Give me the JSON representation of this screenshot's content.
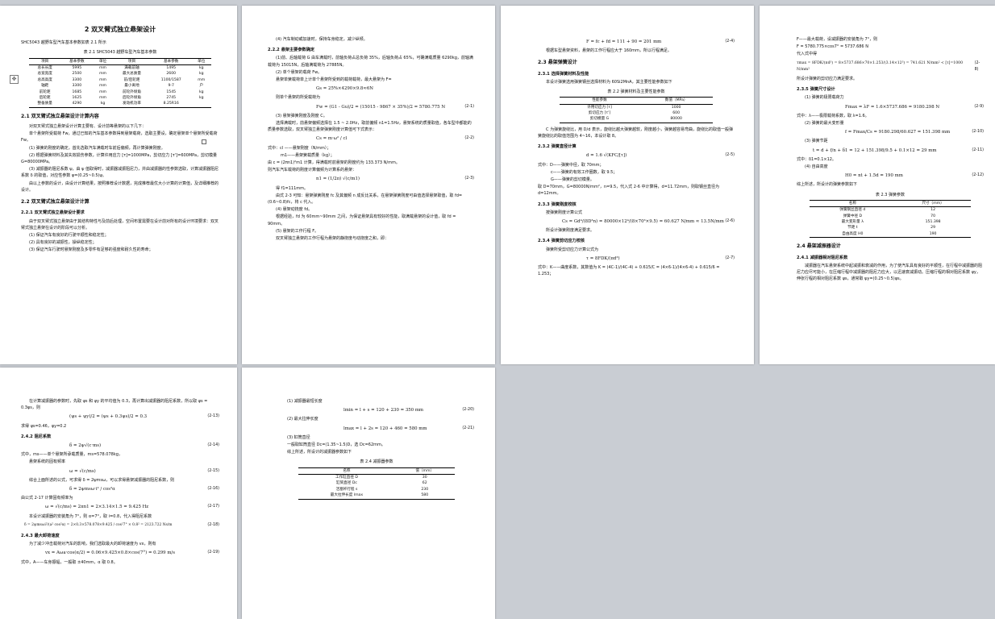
{
  "page1": {
    "chapter_title": "2 双叉臂式独立悬架设计",
    "intro_line": "SHC5043 越野车型汽车基本参数如表 2.1 所示",
    "table_caption": "表 2.1 SHC5043 越野车型汽车基本参数",
    "table_headers": [
      "项目",
      "基本参数",
      "单位",
      "项目",
      "基本参数",
      "单位"
    ],
    "table_rows": [
      [
        "总长长度",
        "5995",
        "mm",
        "满载前轴",
        "1495",
        "kg"
      ],
      [
        "总宽宽度",
        "2500",
        "mm",
        "最大总质量",
        "2600",
        "kg"
      ],
      [
        "总高高度",
        "3300",
        "mm",
        "前/后轮距",
        "1100/1587",
        "mm"
      ],
      [
        "轴距",
        "3300",
        "mm",
        "最小离地",
        "9-7",
        "户"
      ],
      [
        "前轮距",
        "1685",
        "mm",
        "前轮外倾角",
        "1545",
        "kg"
      ],
      [
        "后轮距",
        "1625",
        "mm",
        "后轮外倾角",
        "2745",
        "kg"
      ],
      [
        "整备质量",
        "4290",
        "kg",
        "发动机功率",
        "8.25R16",
        ""
      ]
    ],
    "s21_title": "2.1 双叉臂式独立悬架设计计算内容",
    "s21_paras": [
      "对双叉臂式独立悬架设计计算主要有、设计前等悬架的以下几下：",
      "单个悬架所受载荷 Fw，通过已知的汽车基本参数得到悬架载荷，选取主要设，确定悬架单个悬架所受载荷 Fw。",
      "(1) 弹簧的刚度的确定，首先选取汽车满载时车前后偏频，再计算弹簧刚度。",
      "(2) 根据弹簧材料及其失效损伤参数，计算许用应力 [τ]=1000MPa，剪切应力 [τ']=600MPa，剪切模量 G=80000MPa。",
      "(3) 减振器的阻尼系数 ψ，由 ψ 值取得时，减振器减振阻尼力，并由减振器的性参数选取，计算减振器阻尼系数 δ 的取值，对应性参数 ψ=(0.25~0.5)ψ。",
      "由以上参数的设计，由设计计算结果，按照推荐设计数据，完成推荐最优大小计算的计算值，及详细推荐的设计。"
    ],
    "s22_title": "2.2 双叉臂式独立悬架设计计算",
    "s221_title": "2.2.1 双叉臂式独立悬架设计要求",
    "s221_paras": [
      "由于双叉臂式独立悬架由于其结构特性与及前后处理，空间布置需要在设计前对所有的设计环境要求：双叉臂式独立悬架在设计的阶段可以分析。",
      "(1) 保证汽车有良好的行驶平顺性和稳定性；",
      "(2) 具有良好的减振性，操纵稳定性；",
      "(3) 保证汽车行驶时悬架刚度及多零件有足够的强度和耐久性的寿命；"
    ]
  },
  "page2": {
    "top_line": "(4) 汽车制动或加速时，保持车身稳定，减少纵倾。",
    "s222_title": "2.2.2 悬架主要参数确定",
    "paras_a": [
      "(1)前、后轴载荷 G 由车满载时，前轴负荷占总负荷 35%，后轴负荷占 65%，可确满载质量 6290kg，前轴满载荷为 15015N，后轴满载荷为 27885N。",
      "(2) 单个悬架的载荷 Fw。",
      "悬架单簧载荷单上计单个悬架所受到的载荷载荷，最大悬架为 F="
    ],
    "eq_gs": "Gs = 25%×4290×9.8≈6N",
    "para_b": "则单个悬架的所受载荷为",
    "eq_21": "Fw = (G1 - Gu)/2 = (15015 - 9867 × 35%)/2 = 5780.775 N",
    "eq_21_num": "(2-1)",
    "para_c": "(3) 悬架弹簧刚度及刚度 C。",
    "para_d": "选择满载时，前悬架偏频选择在 1.5 ~ 2.0Hz，取前偏频 n1=1.5Hz，悬架系统的质量取值，各车型中都能的质量参数选取，双叉臂独立悬架弹簧刚度计算值可下式表示：",
    "eq_22": "Cs = m·ω² / cl",
    "eq_22_num": "(2-2)",
    "defs": [
      "式中：cl ——悬架刚度（N/mm）；",
      "m1——悬架簧载质量（kg）；",
      "由 c = (2πn1)²m1 计算，得满载时前悬架的刚度约为 133.373 N/mm。",
      "则汽车汽车载荷的刚度计算偏频为计算系的悬架："
    ],
    "eq_23": "n1 = (1/2π) √(c/m1)",
    "eq_23_num": "(2-3)",
    "paras_e": [
      "得 f1=111mm。",
      "由式 2-3 可知：悬架弹簧刚度 fc 及其偏频 n 成反比关系，在悬架弹簧刚度可由值选择悬架取值，取 fd=(0.6~0.8)fc，将 c 代入。",
      "(4) 悬架动挠度 fd。",
      "根据经验，fd 为 60mm~90mm 之间，为保证悬架具有较好的性能，取满载悬架的设计值，取 fd = 90mm。",
      "(5) 悬架的工作行程 F。",
      "双叉臂独立悬架的工作行程为悬架的静挠度与动挠度之和，即："
    ]
  },
  "page3": {
    "eq_24": "F = fc + fd = 111 + 90 = 201 mm",
    "eq_24_num": "(2-4)",
    "line_a": "根据车型悬架资料，悬架的工作行程应大于 160mm，所以行程满足。",
    "s23_title": "2.3 悬架弹簧设计",
    "s231_title": "2.3.1 选择弹簧材料及性能",
    "line_b": "本设计弹簧选用弹簧钢丝选择材料为 60Si2MnA，其主要性能参数如下",
    "table_caption": "表 2.2 弹簧材料及主要性能参数",
    "table_headers": [
      "性能参数",
      "数值（MPa）"
    ],
    "table_rows": [
      [
        "许用切应力 [τ]",
        "1000"
      ],
      [
        "剪切应力 [τ']",
        "600"
      ],
      [
        "剪切模量 G",
        "80000"
      ]
    ],
    "line_c": "C 为弹簧旋绕比，用 D/d 表示，旋绕比越大弹簧越软，刚度越小，弹簧越容易弯曲，旋绕比的取值一般弹簧旋绕比的取值范围为 4~16，本设计取 8。",
    "s232_title": "2.3.2 弹簧直径计算",
    "eq_25": "d = 1.6 √(KFC/[τ])",
    "eq_25_num": "(2-5)",
    "defs": [
      "式中：D——弹簧中径，取 70mm；",
      "c——弹簧的有效工作圈数，取 9.5；",
      "G——弹簧的剪切模量。",
      "取 D=70mm，G=80000N/mm²，n=9.5，代入式 2-6 中计算得，d=11.72mm，则取钢丝直径为 d=12mm。"
    ],
    "s233_title": "2.3.3 弹簧刚度校核",
    "line_d": "按弹簧刚度计算公式",
    "eq_26": "Cs = Gd⁴/(8D³n) = 80000×12⁴/(8×70³×9.5) = 60.627 N/mm ≈ 13.5N/mm",
    "eq_26_num": "(2-6)",
    "line_e": "所设计弹簧刚度满足要求。",
    "s234_title": "2.3.4 弹簧剪切应力校核",
    "line_f": "弹簧所受剪切应力计算公式为",
    "eq_27": "τ = 8FDK/(πd³)",
    "eq_27_num": "(2-7)",
    "line_g": "式中：K——曲度系数，其数值为 K = (4C-1)/(4C-4) + 0.615/C = (4×6-1)/(4×6-4) + 0.615/6 = 1.253；"
  },
  "page4": {
    "line_a": "F——最大载荷，设减振器的安装角为 7°，则",
    "line_b": "F = 5780.775×cos7° = 5737.686 N",
    "line_c": "代入式中得",
    "eq_main": "τmax = 8FDK/(πd³) = 8×5737.686×70×1.253/(3.14×12³) = 741.621 N/mm² < [τ]=1000 N/mm²",
    "eq_main_num": "(2-8)",
    "line_d": "所设计弹簧的剪切应力满足要求。",
    "s235_title": "2.3.5 弹簧尺寸设计",
    "line_e": "(1) 弹簧的极限载荷力",
    "eq_29": "Fmax = λF = 1.6×5737.686 = 9180.298 N",
    "eq_29_num": "(2-9)",
    "line_f": "式中：λ——极限载荷系数，取 λ=1.6。",
    "line_g": "(2) 弹簧的最大变形量",
    "eq_210": "f = Fmax/Cs = 9180.298/60.627 = 151.398 mm",
    "eq_210_num": "(2-10)",
    "line_h": "(3) 弹簧节距",
    "eq_211": "t = d + f/n + δ1 = 12 + 151.398/9.5 + 0.1×12 = 29 mm",
    "eq_211_num": "(2-11)",
    "line_i": "式中：δ1=0.1×12。",
    "line_j": "(4) 自由高度",
    "eq_212": "H0 = nt + 1.5d = 190 mm",
    "eq_212_num": "(2-12)",
    "line_k": "综上所述，所设计的弹簧参数如下",
    "table_caption": "表 2.3 弹簧参数",
    "table_headers": [
      "名称",
      "尺寸（mm）"
    ],
    "table_rows": [
      [
        "弹簧钢丝直径 d",
        "12"
      ],
      [
        "弹簧中径 D",
        "70"
      ],
      [
        "最大变形量 λ",
        "151.398"
      ],
      [
        "节距 t",
        "29"
      ],
      [
        "自由高度 H0",
        "190"
      ]
    ],
    "s24_title": "2.4 悬架减振器设计",
    "s241_title": "2.4.1 减振器相对阻尼系数",
    "paras": [
      "减振器在汽车悬架系统中起减振和衰减的作用，为了使汽车具有良好的平顺性，在行程中减振器的阻尼力应尽可能小，在压缩行程中减振器的阻尼力应大，以迅速衰减振动。压缩行程的相对阻尼系数 ψy，伸张行程的相对阻尼系数 ψs，通常取 ψy=(0.25~0.5)ψs。"
    ]
  },
  "page5": {
    "paras_a": [
      "在计算减振器的参数时，先取 ψs 和 ψy 的平均值为 0.3，再计算出减振器的阻尼系数，所以取 ψs = 0.3ψs，则"
    ],
    "eq_213": "(ψs + ψy)/2 = (ψs + 0.3ψs)/2 = 0.3",
    "eq_213_num": "(2-13)",
    "line_a": "求得 ψs=0.46，ψy=0.2",
    "s242_title": "2.4.2 阻尼系数",
    "eq_214": "δ = 2ψ√(c·ms)",
    "eq_214_num": "(2-14)",
    "defs": [
      "式中，ms——单个悬架所承载质量，ms=578.078kg，",
      "悬架系统的固有频率"
    ],
    "eq_215": "ω = √(c/ms)",
    "eq_215_num": "(2-15)",
    "line_b": "综合上面所述的公式，可求得 δ = 2ψmsω，可以求得悬架减振器的阻尼系数，则",
    "eq_216": "δ = 2ψmsω·i² / cos²α",
    "eq_216_num": "(2-16)",
    "line_c": "由公式 2-17 计算固有频率为",
    "eq_217": "ω = √(c/ms) = 2πn1 = 2×3.14×1.5 = 9.425 Hz",
    "eq_217_num": "(2-17)",
    "line_d": "本设计减振器的安装角为 7°，则 α=7°，取 i=0.8，代入得阻尼系数",
    "eq_218": "δ = 2ψmsωi²/(a² cos²α) = 2×0.3×578.078×9.425 / cos²7° × 0.8² = 2123.722 Ns/m",
    "eq_218_num": "(2-18)",
    "s243_title": "2.4.3 最大卸荷速度",
    "line_e": "为了减少冲击载荷对汽车的影响，我们选取最大的卸荷速度为 vx，则有",
    "eq_219": "vx = Aωa·cos(α/2) = 0.06×9.425×0.8×cos(7°) = 0.299 m/s",
    "eq_219_num": "(2-19)",
    "line_f": "式中，A——车身振幅，一般取 ±40mm，α 取 0.8。"
  },
  "page6": {
    "line_a": "(1) 减振器最短长度",
    "eq_220": "lmin = l + s = 120 + 230 = 350 mm",
    "eq_220_num": "(2-20)",
    "line_b": "(2) 最大拉伸长度",
    "eq_221": "lmax = l + 2s = 120 + 460 = 580 mm",
    "eq_221_num": "(2-21)",
    "line_c": "(3) 缸筒直径",
    "line_d": "一般取缸筒直径 Dc=(1.35~1.5)D，选 Dc=62mm。",
    "line_e": "综上所述，所设计的减振器参数如下",
    "table_caption": "表 2.4 减振器参数",
    "table_headers": [
      "名称",
      "值（mm）"
    ],
    "table_rows": [
      [
        "工作缸直径 D",
        "30"
      ],
      [
        "缸筒直径 Dc",
        "62"
      ],
      [
        "活塞杆行程 s",
        "230"
      ],
      [
        "最大拉伸长度 lmax",
        "580"
      ]
    ]
  }
}
